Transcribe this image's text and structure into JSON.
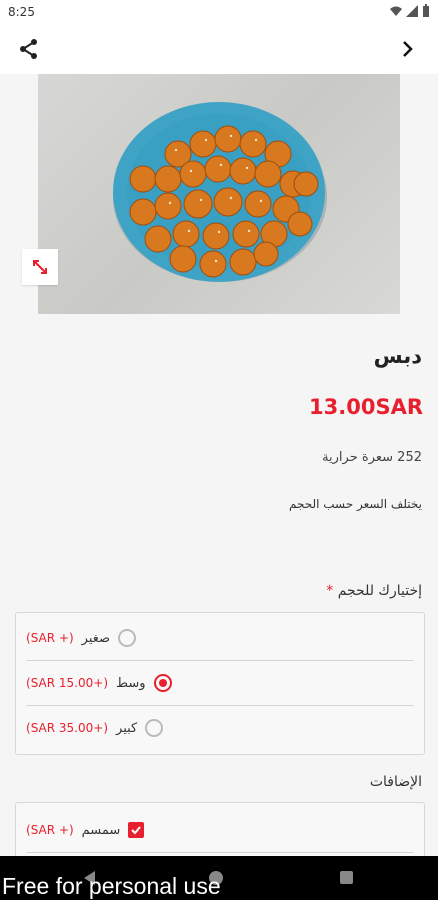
{
  "status_bar": {
    "time": "8:25"
  },
  "product": {
    "name": "دبس",
    "price": "13.00SAR",
    "calories": "252 سعرة حرارية",
    "note": "يختلف السعر حسب الحجم"
  },
  "size_section": {
    "title": "إختيارك للحجم",
    "required_mark": "*",
    "options": [
      {
        "label": "صغير",
        "price": "(+ SAR)",
        "selected": false
      },
      {
        "label": "وسط",
        "price": "(+15.00 SAR)",
        "selected": true
      },
      {
        "label": "كبير",
        "price": "(+35.00 SAR)",
        "selected": false
      }
    ]
  },
  "addons_section": {
    "title": "الإضافات",
    "options": [
      {
        "label": "سمسم",
        "price": "(+ SAR)",
        "checked": true
      }
    ]
  },
  "watermark": "Free for personal use",
  "colors": {
    "accent": "#e8202e",
    "dish": "#3fa3c6"
  },
  "icons": [
    "share-icon",
    "chevron-right-icon",
    "expand-icon",
    "wifi-icon",
    "signal-icon",
    "battery-icon"
  ]
}
